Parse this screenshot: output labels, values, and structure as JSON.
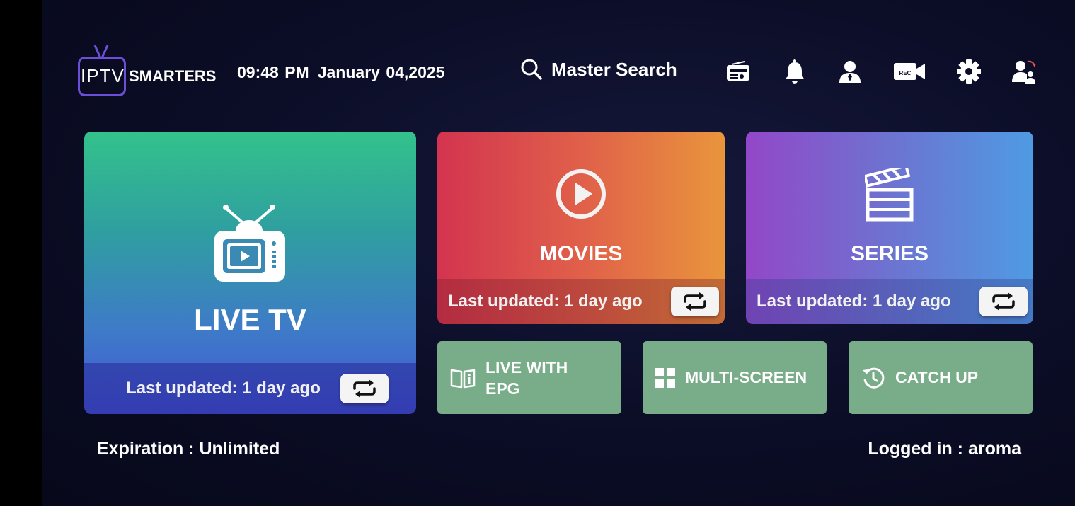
{
  "header": {
    "logo": {
      "text_iptv": "IPTV",
      "text_smarters": "SMARTERS"
    },
    "time": "09:48 PM",
    "date": "January 04,2025",
    "search_label": "Master Search",
    "icons": [
      "radio-icon",
      "bell-icon",
      "user-icon",
      "rec-camera-icon",
      "gear-icon",
      "switch-user-icon"
    ],
    "rec_text": "REC"
  },
  "tiles": {
    "live": {
      "title": "LIVE TV",
      "updated": "Last updated: 1 day ago"
    },
    "movies": {
      "title": "MOVIES",
      "updated": "Last updated: 1 day ago"
    },
    "series": {
      "title": "SERIES",
      "updated": "Last updated: 1 day ago"
    }
  },
  "small_tiles": {
    "epg": "LIVE WITH EPG",
    "multi": "MULTI-SCREEN",
    "catch": "CATCH UP"
  },
  "footer": {
    "expiration": "Expiration : Unlimited",
    "logged_in": "Logged in : aroma"
  },
  "colors": {
    "background": "#0b0d26",
    "live_top": "#33c28b",
    "live_bottom": "#4356d6",
    "movies_left": "#d3344f",
    "movies_right": "#e9953c",
    "series_left": "#9347c8",
    "series_right": "#4f9be3",
    "small_tile": "#79ad8a",
    "logo_accent": "#6b4fd8"
  }
}
